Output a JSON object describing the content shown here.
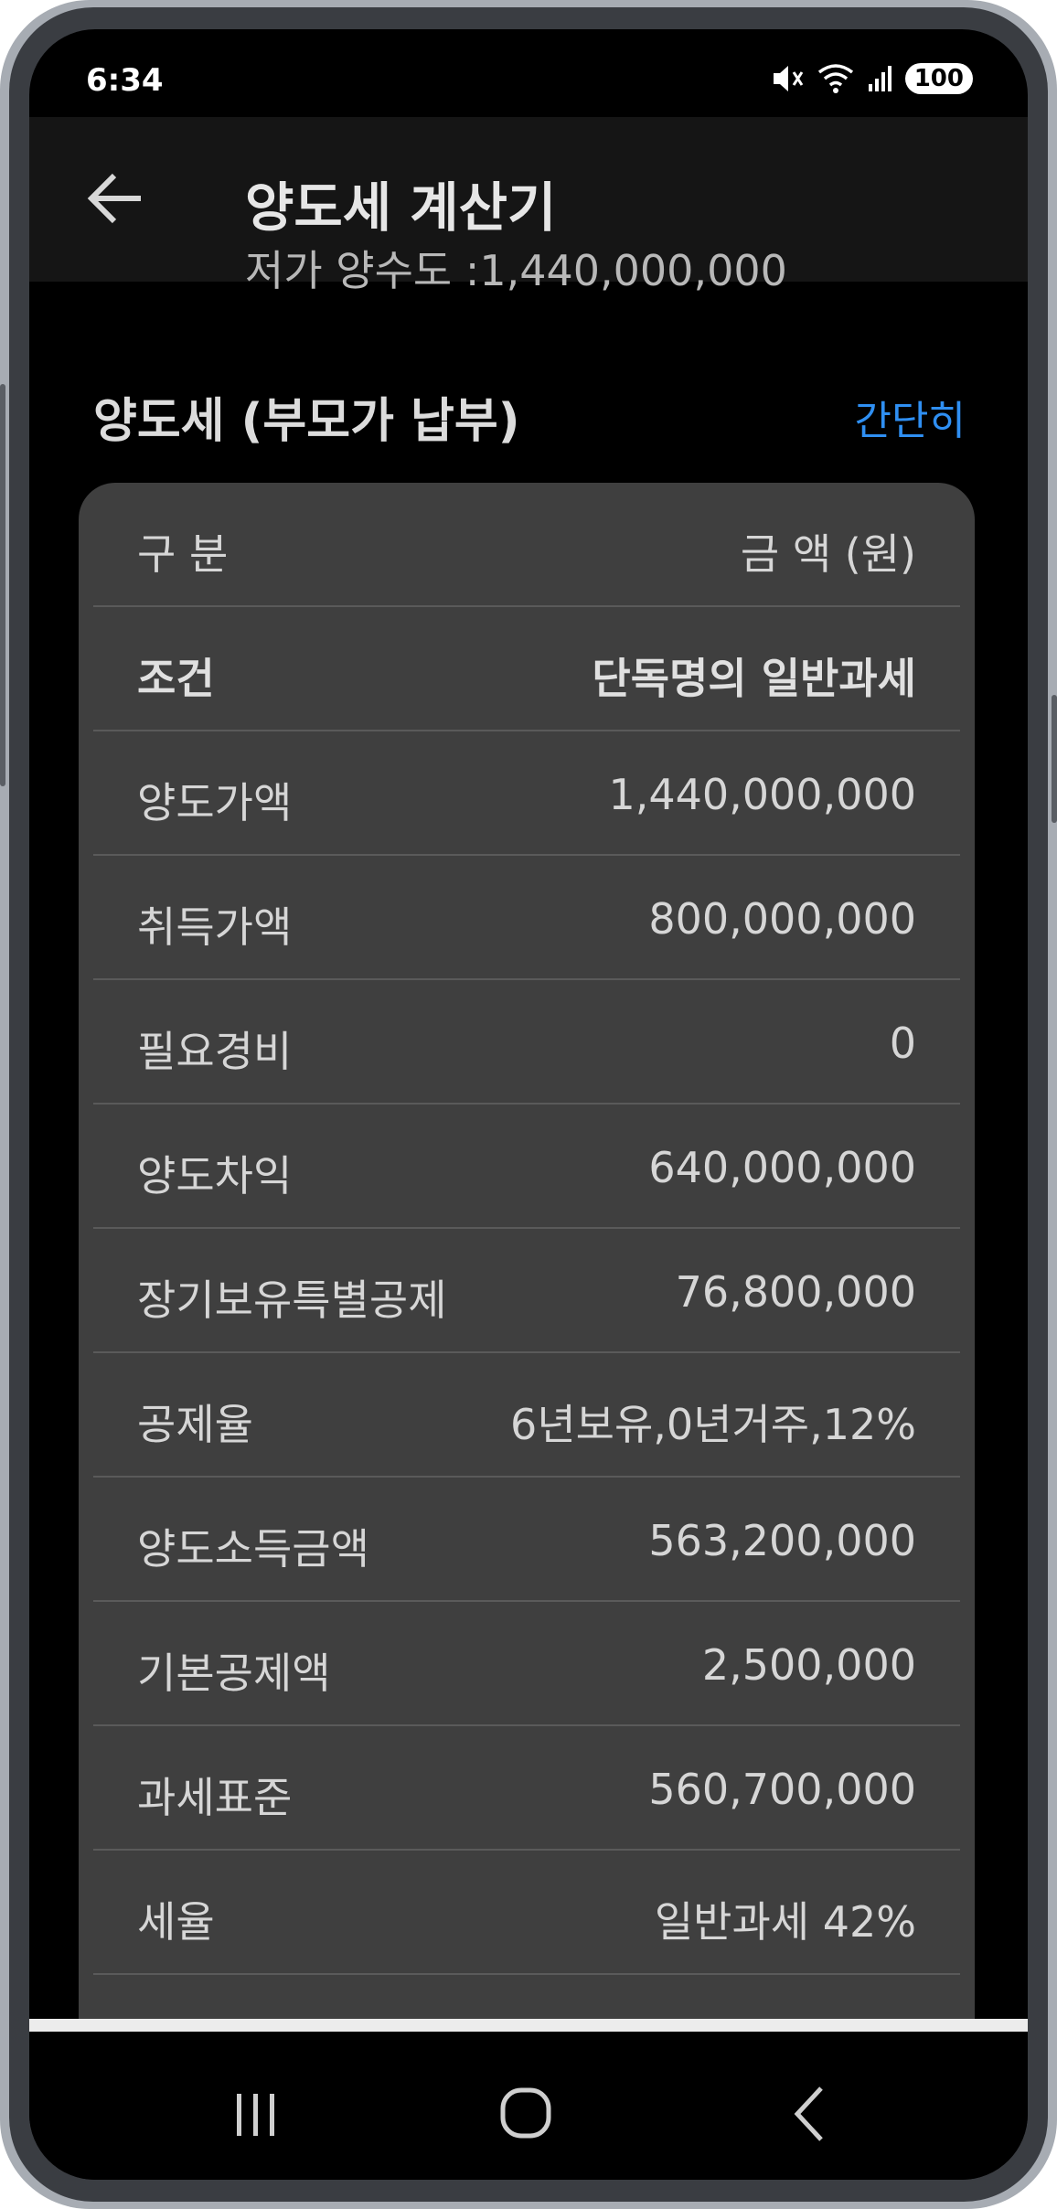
{
  "status_bar": {
    "time": "6:34",
    "battery": "100",
    "icons": [
      "mute-icon",
      "wifi-icon",
      "signal-icon"
    ]
  },
  "app_bar": {
    "title": "양도세 계산기",
    "subtitle": "저가 양수도 :1,440,000,000"
  },
  "section": {
    "title": "양도세 (부모가 납부)",
    "action_label": "간단히"
  },
  "table": {
    "header": {
      "label": "구 분",
      "value": "금 액 (원)"
    },
    "rows": [
      {
        "label": "조건",
        "value": "단독명의 일반과세"
      },
      {
        "label": "양도가액",
        "value": "1,440,000,000"
      },
      {
        "label": "취득가액",
        "value": "800,000,000"
      },
      {
        "label": "필요경비",
        "value": "0"
      },
      {
        "label": "양도차익",
        "value": "640,000,000"
      },
      {
        "label": "장기보유특별공제",
        "value": "76,800,000"
      },
      {
        "label": "공제율",
        "value": "6년보유,0년거주,12%"
      },
      {
        "label": "양도소득금액",
        "value": "563,200,000"
      },
      {
        "label": "기본공제액",
        "value": "2,500,000"
      },
      {
        "label": "과세표준",
        "value": "560,700,000"
      },
      {
        "label": "세율",
        "value": "일반과세 42%"
      }
    ]
  },
  "colors": {
    "accent": "#2f8ff2",
    "card": "#3f3f3f",
    "background": "#000000"
  }
}
